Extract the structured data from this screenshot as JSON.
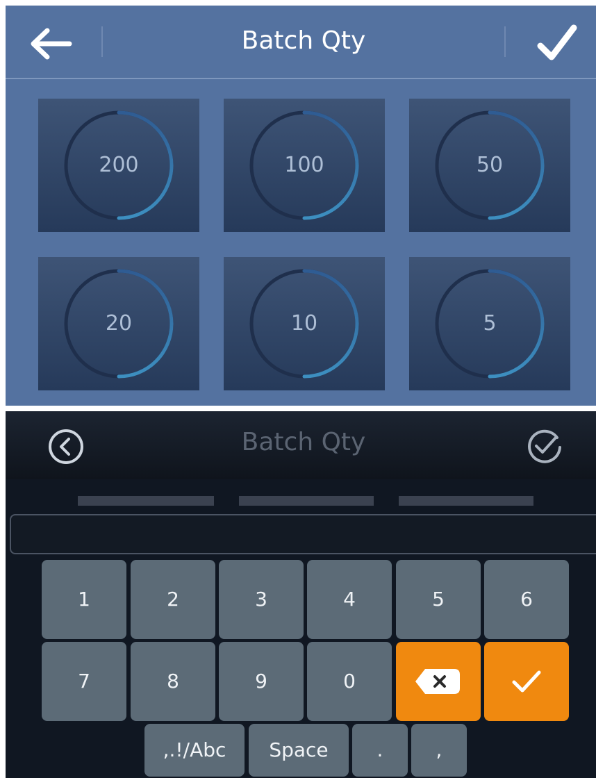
{
  "panel1": {
    "title": "Batch Qty",
    "back_icon": "arrow-left-icon",
    "confirm_icon": "checkmark-icon",
    "presets": [
      {
        "label": "200"
      },
      {
        "label": "100"
      },
      {
        "label": "50"
      },
      {
        "label": "20"
      },
      {
        "label": "10"
      },
      {
        "label": "5"
      }
    ]
  },
  "panel2": {
    "title": "Batch Qty",
    "back_icon": "circle-chevron-left-icon",
    "confirm_icon": "circle-check-icon",
    "input_value": "",
    "keypad": {
      "row1": [
        "1",
        "2",
        "3",
        "4",
        "5",
        "6"
      ],
      "row2": [
        "7",
        "8",
        "9",
        "0"
      ],
      "backspace_icon": "backspace-icon",
      "enter_icon": "checkmark-icon",
      "row3": [
        ",.!/Abc",
        "Space",
        ".",
        ","
      ]
    }
  },
  "colors": {
    "panel1_bg": "#5472a0",
    "tile_bg": "#2f4467",
    "ring_accent": "#3d8fc0",
    "panel2_bg": "#101722",
    "key_bg": "#5c6b77",
    "key_accent": "#f0890f"
  }
}
